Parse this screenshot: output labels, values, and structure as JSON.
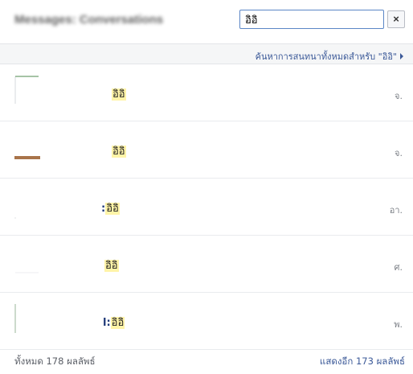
{
  "header": {
    "title": "Messages: Conversations"
  },
  "search": {
    "value": "อิอิ",
    "clear_label": "×"
  },
  "search_all": {
    "label": "ค้นหาการสนทนาทั้งหมดสำหรับ \"อิอิ\""
  },
  "results": [
    {
      "prefix": "",
      "match": "อิอิ",
      "day": "จ."
    },
    {
      "prefix": "",
      "match": "อิอิ",
      "day": "จ."
    },
    {
      "prefix": ":",
      "match": "อิอิ",
      "day": "อา."
    },
    {
      "prefix": "",
      "match": "อิอิ",
      "day": "ศ."
    },
    {
      "prefix": "l:",
      "match": "อิอิ",
      "day": "พ."
    }
  ],
  "footer": {
    "total": "ทั้งหมด 178 ผลลัพธ์",
    "more": "แสดงอีก 173 ผลลัพธ์"
  },
  "colors": {
    "accent": "#3b5998",
    "highlight": "#fff4a8",
    "input_border": "#5b86c6"
  }
}
